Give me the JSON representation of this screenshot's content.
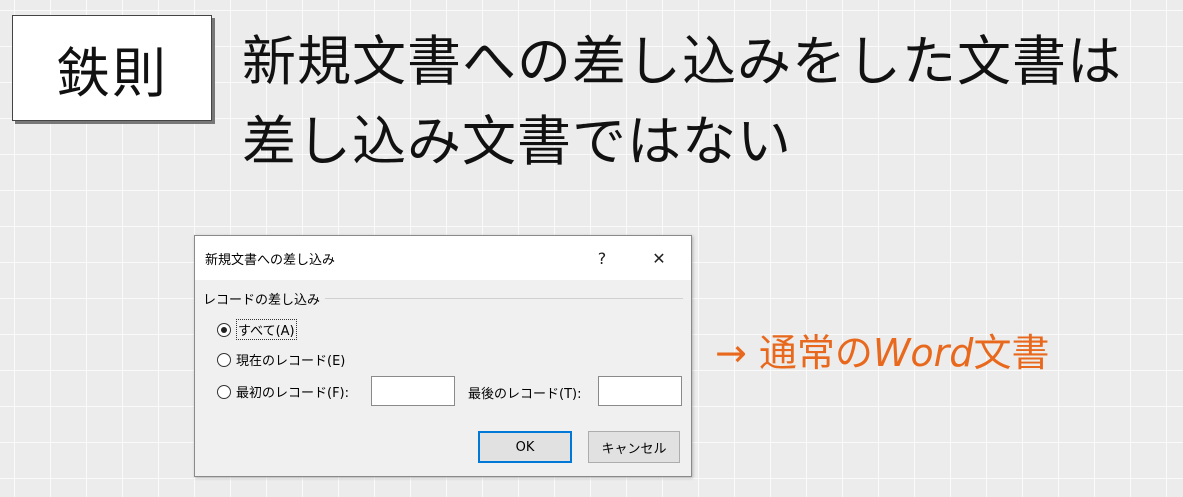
{
  "rule_label": "鉄則",
  "headline": {
    "line1": "新規文書への差し込みをした文書は",
    "line2": "差し込み文書ではない"
  },
  "dialog": {
    "title": "新規文書への差し込み",
    "help_label": "?",
    "close_label": "✕",
    "group_label": "レコードの差し込み",
    "options": {
      "all": "すべて(A)",
      "current": "現在のレコード(E)",
      "first": "最初のレコード(F):"
    },
    "selected_option": "all",
    "first_value": "",
    "last_label": "最後のレコード(T):",
    "last_value": "",
    "ok_label": "OK",
    "cancel_label": "キャンセル"
  },
  "note": {
    "arrow": "→",
    "prefix": "通常の",
    "word": "Word",
    "suffix": "文書",
    "color": "#e8691d"
  }
}
